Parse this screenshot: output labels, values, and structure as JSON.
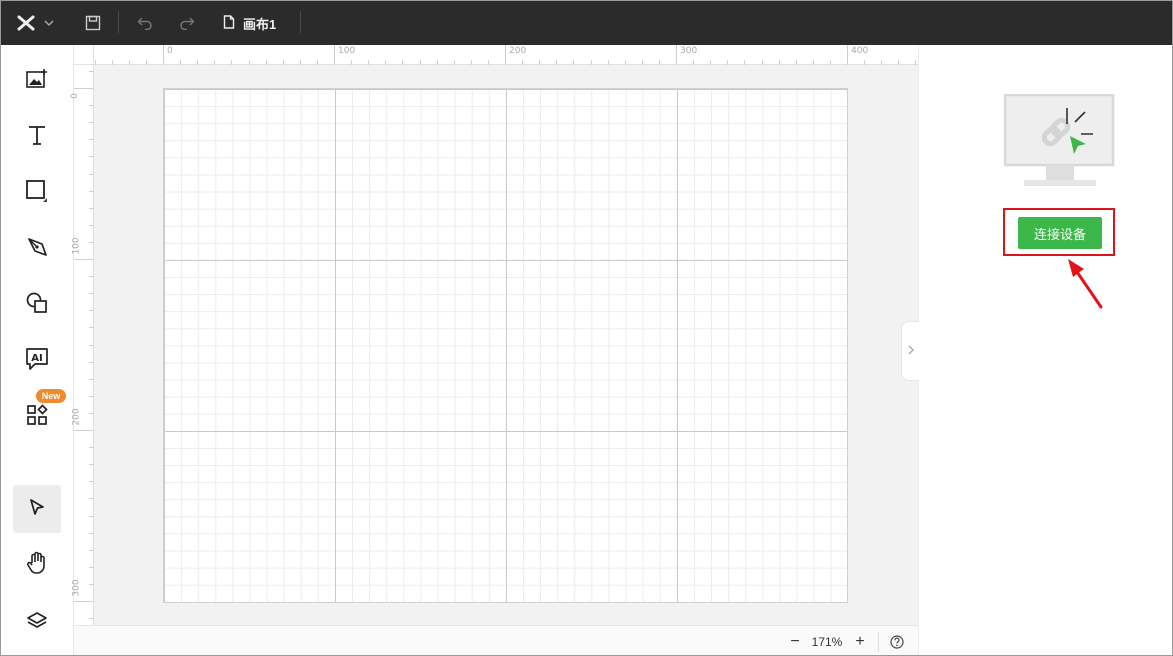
{
  "topbar": {
    "document_title": "画布1",
    "logo_icon": "x-logo-icon",
    "icons": [
      "chevron-down-icon",
      "save-icon",
      "undo-icon",
      "redo-icon",
      "file-icon"
    ]
  },
  "left_toolbar": {
    "tools": [
      {
        "name": "add-image",
        "icon": "image-plus-icon"
      },
      {
        "name": "text",
        "icon": "text-icon"
      },
      {
        "name": "rectangle",
        "icon": "square-icon"
      },
      {
        "name": "pen",
        "icon": "pen-icon"
      },
      {
        "name": "shapes",
        "icon": "shapes-icon"
      },
      {
        "name": "ai",
        "icon": "ai-icon"
      },
      {
        "name": "apps",
        "icon": "apps-icon"
      },
      {
        "name": "select",
        "icon": "cursor-icon",
        "active": true
      },
      {
        "name": "hand",
        "icon": "hand-icon"
      },
      {
        "name": "layers",
        "icon": "layers-icon"
      }
    ],
    "new_badge": "New"
  },
  "rulers": {
    "top_labels": [
      "0",
      "100",
      "200",
      "300",
      "400"
    ],
    "left_labels": [
      "0",
      "100",
      "200",
      "300"
    ]
  },
  "bottombar": {
    "zoom_label": "171%",
    "zoom_out": "−",
    "zoom_in": "+",
    "help_icon": "help-icon"
  },
  "right_panel": {
    "device_icon": "monitor-link-icon",
    "connect_button": "连接设备",
    "highlight_color": "#d9141a",
    "button_color": "#3cb84a"
  }
}
